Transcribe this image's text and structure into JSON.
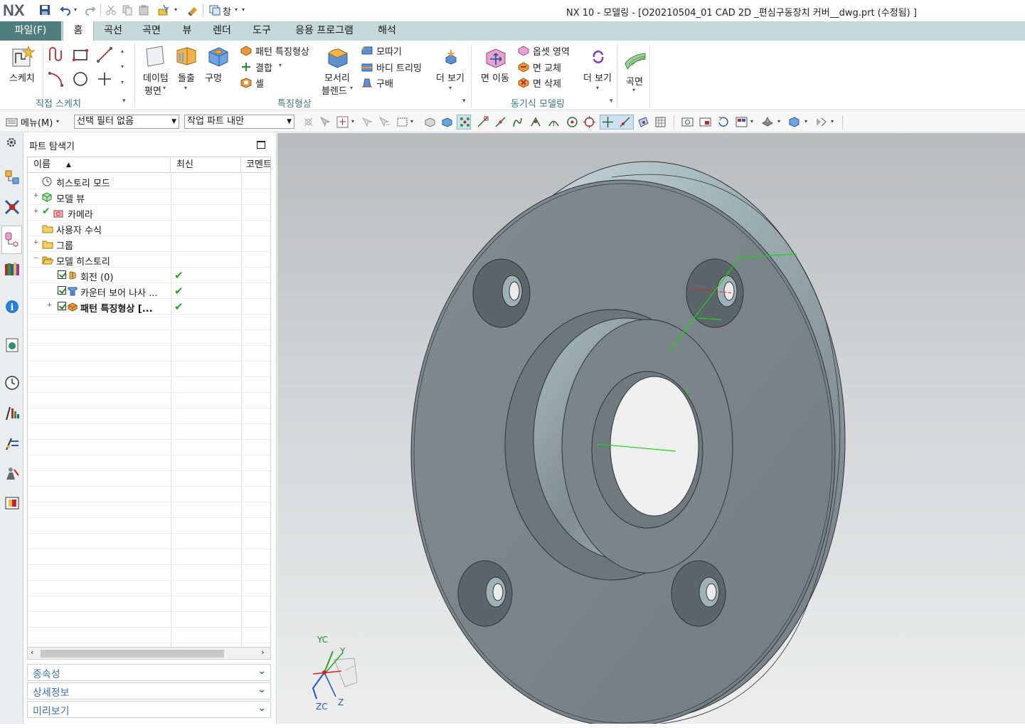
{
  "app": {
    "logo": "NX",
    "window_title": "NX 10 - 모델링 - [O20210504_01 CAD 2D _편심구동장치 커버__dwg.prt (수정됨) ]",
    "window_menu_label": "창"
  },
  "menu": {
    "file": "파일(F)",
    "tabs": [
      "홈",
      "곡선",
      "곡면",
      "뷰",
      "렌더",
      "도구",
      "응용 프로그램",
      "해석"
    ]
  },
  "ribbon": {
    "sketch_label": "스케치",
    "direct_sketch_group": "직접 스케치",
    "datum_plane": [
      "데이텀",
      "평면"
    ],
    "extrude": "돌출",
    "hole": "구멍",
    "pattern_feature": "패턴 특징형상",
    "unite": "결합",
    "shell": "셸",
    "edge_blend": [
      "모서리",
      "블렌드"
    ],
    "chamfer": "모따기",
    "trim_body": "바디 트리밍",
    "draft": "구배",
    "more_1": "더 보기",
    "feature_group": "특징형상",
    "move_face": "면 이동",
    "offset_region": "옵셋 영역",
    "replace_face": "면 교체",
    "delete_face": "면 삭제",
    "more_2": "더 보기",
    "sync_group": "동기식 모델링",
    "surface": "곡면"
  },
  "selection_bar": {
    "menu": "메뉴(M)",
    "type_filter": "선택 필터 없음",
    "scope": "작업 파트 내만"
  },
  "navigator": {
    "title": "파트 탐색기",
    "columns": [
      "이름",
      "최신",
      "코멘트"
    ],
    "rows": [
      {
        "label": "히스토리 모드",
        "latest": ""
      },
      {
        "label": "모델 뷰",
        "latest": ""
      },
      {
        "label": "카메라",
        "latest": ""
      },
      {
        "label": "사용자 수식",
        "latest": ""
      },
      {
        "label": "그룹",
        "latest": ""
      },
      {
        "label": "모델 히스토리",
        "latest": ""
      },
      {
        "label": "회전 (0)",
        "latest": "✔"
      },
      {
        "label": "카운터 보어 나사 ...",
        "latest": "✔"
      },
      {
        "label": "패턴 특징형상 [...",
        "latest": "✔"
      }
    ],
    "panels": [
      "종속성",
      "상세정보",
      "미리보기"
    ]
  },
  "triad": {
    "yc": "YC",
    "y": "Y",
    "zc": "ZC",
    "z": "Z"
  },
  "colors": {
    "menubar": "#c5dad8",
    "file_tab": "#4e7f7e",
    "part_body": "#7c878c",
    "part_highlight": "#c9dde3",
    "green_edge": "#19d219"
  }
}
